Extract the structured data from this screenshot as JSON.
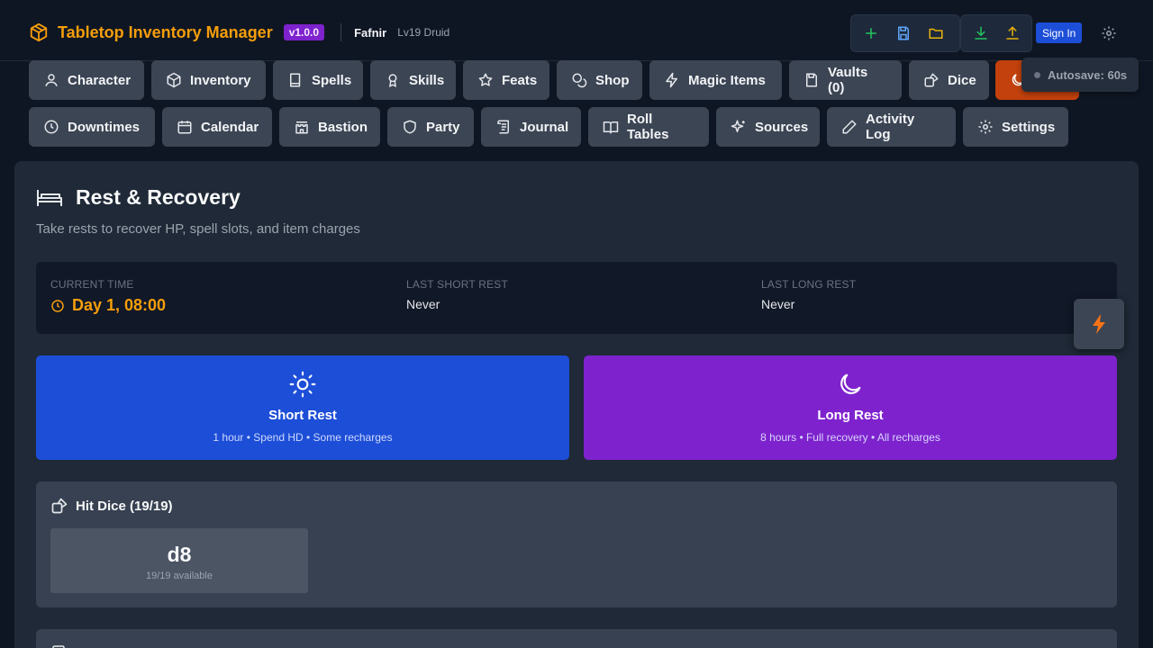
{
  "app": {
    "title": "Tabletop Inventory Manager",
    "version": "v1.0.0",
    "character_name": "Fafnir",
    "character_sub": "Lv19 Druid"
  },
  "toolbar": {
    "add_icon": "plus-icon",
    "save_icon": "save-icon",
    "open_icon": "folder-icon",
    "import_icon": "download-icon",
    "export_icon": "upload-icon",
    "sign_in_label": "Sign In",
    "settings_icon": "gear-icon"
  },
  "tabs_row1": [
    {
      "label": "Character",
      "icon": "user-icon"
    },
    {
      "label": "Inventory",
      "icon": "box-icon"
    },
    {
      "label": "Spells",
      "icon": "book-icon"
    },
    {
      "label": "Skills",
      "icon": "award-icon"
    },
    {
      "label": "Feats",
      "icon": "star-icon"
    },
    {
      "label": "Shop",
      "icon": "coins-icon"
    },
    {
      "label": "Magic Items",
      "icon": "zap-icon"
    },
    {
      "label": "Vaults (0)",
      "icon": "vault-icon"
    },
    {
      "label": "Dice",
      "icon": "dice-icon"
    },
    {
      "label": "",
      "icon": "moon-icon"
    }
  ],
  "tabs_row2": [
    {
      "label": "Downtimes",
      "icon": "clock-icon"
    },
    {
      "label": "Calendar",
      "icon": "calendar-icon"
    },
    {
      "label": "Bastion",
      "icon": "castle-icon"
    },
    {
      "label": "Party",
      "icon": "shield-icon"
    },
    {
      "label": "Journal",
      "icon": "scroll-icon"
    },
    {
      "label": "Roll Tables",
      "icon": "open-book-icon"
    },
    {
      "label": "Sources",
      "icon": "sparkles-icon"
    },
    {
      "label": "Activity Log",
      "icon": "pencil-icon"
    },
    {
      "label": "Settings",
      "icon": "gear-icon"
    }
  ],
  "autosave": {
    "label": "Autosave: 60s"
  },
  "rest": {
    "title": "Rest & Recovery",
    "subtitle": "Take rests to recover HP, spell slots, and item charges",
    "current_time_label": "CURRENT TIME",
    "current_time_value": "Day 1, 08:00",
    "last_short_label": "LAST SHORT REST",
    "last_short_value": "Never",
    "last_long_label": "LAST LONG REST",
    "last_long_value": "Never",
    "short_rest": {
      "title": "Short Rest",
      "desc": "1 hour • Spend HD • Some recharges",
      "color": "#1d4ed8"
    },
    "long_rest": {
      "title": "Long Rest",
      "desc": "8 hours • Full recovery • All recharges",
      "color": "#7e22ce"
    },
    "hit_dice": {
      "title": "Hit Dice (19/19)",
      "die": "d8",
      "available": "19/19 available"
    }
  },
  "colors": {
    "accent": "#f59e0b",
    "active_tab": "#c2410c",
    "background": "#0f1623"
  }
}
